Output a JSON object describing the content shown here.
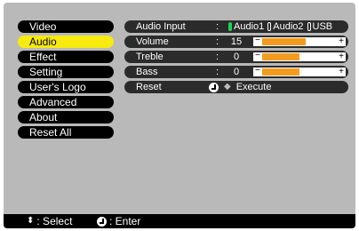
{
  "menu": {
    "items": [
      {
        "label": "Video",
        "selected": false
      },
      {
        "label": "Audio",
        "selected": true
      },
      {
        "label": "Effect",
        "selected": false
      },
      {
        "label": "Setting",
        "selected": false
      },
      {
        "label": "User's Logo",
        "selected": false
      },
      {
        "label": "Advanced",
        "selected": false
      },
      {
        "label": "About",
        "selected": false
      },
      {
        "label": "Reset All",
        "selected": false
      }
    ]
  },
  "panel": {
    "audio_input": {
      "label": "Audio Input",
      "colon": ":",
      "options": [
        "Audio1",
        "Audio2",
        "USB"
      ],
      "selected_index": 0
    },
    "volume": {
      "label": "Volume",
      "colon": ":",
      "value": "15",
      "level_fraction": 0.58
    },
    "treble": {
      "label": "Treble",
      "colon": ":",
      "value": "0",
      "level_fraction": 0.5
    },
    "bass": {
      "label": "Bass",
      "colon": ":",
      "value": "0",
      "level_fraction": 0.5
    },
    "reset": {
      "label": "Reset",
      "action": "Execute"
    }
  },
  "footer": {
    "select_text": ": Select",
    "enter_text": ": Enter"
  },
  "colors": {
    "selected_menu_bg": "#f6ea0e",
    "slider_fill": "#f39b1f",
    "radio_on": "#1dd35b"
  }
}
